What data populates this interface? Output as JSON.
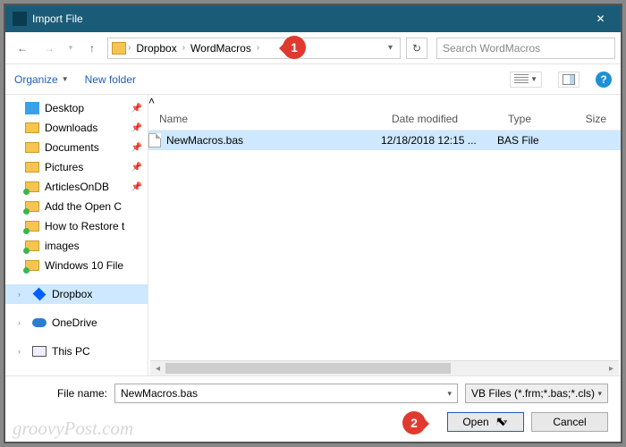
{
  "window": {
    "title": "Import File"
  },
  "nav": {
    "crumbs": [
      "Dropbox",
      "WordMacros"
    ],
    "search_placeholder": "Search WordMacros"
  },
  "toolbar": {
    "organize": "Organize",
    "newfolder": "New folder"
  },
  "sidebar": {
    "items": [
      {
        "label": "Desktop",
        "icon": "desktop",
        "pinned": true
      },
      {
        "label": "Downloads",
        "icon": "folder",
        "pinned": true
      },
      {
        "label": "Documents",
        "icon": "folder",
        "pinned": true
      },
      {
        "label": "Pictures",
        "icon": "folder",
        "pinned": true
      },
      {
        "label": "ArticlesOnDB",
        "icon": "folder green",
        "pinned": true
      },
      {
        "label": "Add the Open C",
        "icon": "folder green",
        "pinned": false
      },
      {
        "label": "How to Restore t",
        "icon": "folder green",
        "pinned": false
      },
      {
        "label": "images",
        "icon": "folder green",
        "pinned": false
      },
      {
        "label": "Windows 10 File",
        "icon": "folder green",
        "pinned": false
      }
    ],
    "roots": [
      {
        "label": "Dropbox",
        "icon": "dropbox",
        "selected": true
      },
      {
        "label": "OneDrive",
        "icon": "onedrive"
      },
      {
        "label": "This PC",
        "icon": "thispc"
      }
    ]
  },
  "columns": {
    "name": "Name",
    "date": "Date modified",
    "type": "Type",
    "size": "Size"
  },
  "rows": [
    {
      "name": "NewMacros.bas",
      "date": "12/18/2018 12:15 ...",
      "type": "BAS File",
      "selected": true
    }
  ],
  "footer": {
    "filename_label": "File name:",
    "filename_value": "NewMacros.bas",
    "filter_value": "VB Files (*.frm;*.bas;*.cls)",
    "open_label": "Open",
    "cancel_label": "Cancel"
  },
  "callouts": {
    "one": "1",
    "two": "2"
  },
  "watermark": "groovyPost.com"
}
